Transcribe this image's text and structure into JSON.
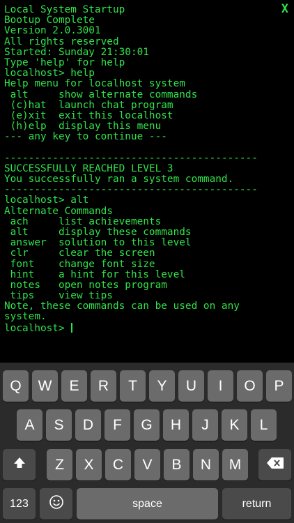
{
  "terminal": {
    "close_label": "X",
    "lines": [
      "Local System Startup",
      "Bootup Complete",
      "Version 2.0.3001",
      "All rights reserved",
      "Started: Sunday 21:30:01",
      "Type 'help' for help",
      "localhost> help",
      "Help menu for localhost system",
      " alt     show alternate commands",
      " (c)hat  launch chat program",
      " (e)xit  exit this localhost",
      " (h)elp  display this menu",
      "--- any key to continue ---",
      "",
      "------------------------------------------",
      "SUCCESSFULLY REACHED LEVEL 3",
      "You successfully ran a system command.",
      "------------------------------------------",
      "localhost> alt",
      "Alternate Commands",
      " ach     list achievements",
      " alt     display these commands",
      " answer  solution to this level",
      " clr     clear the screen",
      " font    change font size",
      " hint    a hint for this level",
      " notes   open notes program",
      " tips    view tips",
      "Note, these commands can be used on any",
      "system."
    ],
    "prompt": "localhost> ",
    "text_color": "#2fe34a"
  },
  "keyboard": {
    "row1": [
      "Q",
      "W",
      "E",
      "R",
      "T",
      "Y",
      "U",
      "I",
      "O",
      "P"
    ],
    "row2": [
      "A",
      "S",
      "D",
      "F",
      "G",
      "H",
      "J",
      "K",
      "L"
    ],
    "row3": [
      "Z",
      "X",
      "C",
      "V",
      "B",
      "N",
      "M"
    ],
    "shift_icon": "shift-icon",
    "delete_icon": "delete-icon",
    "numbers_label": "123",
    "emoji_icon": "emoji-icon",
    "space_label": "space",
    "return_label": "return"
  }
}
